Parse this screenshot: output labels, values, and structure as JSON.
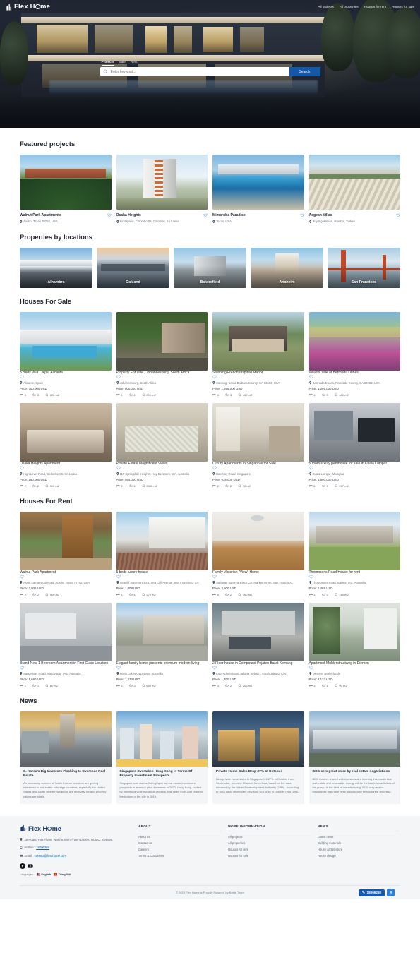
{
  "site": {
    "brand_pre": "Flex H",
    "brand_post": "me",
    "logo_icon": "building-logo-icon"
  },
  "header": {
    "nav": [
      {
        "label": "All projects",
        "name": "nav-all-projects"
      },
      {
        "label": "All properties",
        "name": "nav-all-properties"
      },
      {
        "label": "Houses for rent",
        "name": "nav-houses-for-rent"
      },
      {
        "label": "Houses for sale",
        "name": "nav-houses-for-sale"
      }
    ]
  },
  "search": {
    "tabs": [
      {
        "label": "Projects",
        "active": true
      },
      {
        "label": "Sale",
        "active": false
      },
      {
        "label": "Rent",
        "active": false
      }
    ],
    "placeholder": "Enter keyword...",
    "value": "",
    "button_label": "Search",
    "accent": "#1558a8"
  },
  "featured": {
    "title": "Featured projects",
    "items": [
      {
        "title": "Walnut Park Apartments",
        "address": "Austin, Texas 78753, USA",
        "img": "green-hillside-apartments"
      },
      {
        "title": "Osaka Heights",
        "address": "Kirulapane, Colombo 06, Colombo, Sri Lanka",
        "img": "white-highrise-tower"
      },
      {
        "title": "Mimaroba Paradise",
        "address": "Texas, USA",
        "img": "resort-pool-aerial"
      },
      {
        "title": "Aegean Villas",
        "address": "Büyükçekmece, İstanbul, Turkey",
        "img": "villa-estate-aerial"
      }
    ]
  },
  "locations": {
    "title": "Properties by locations",
    "items": [
      {
        "name": "Alhambra",
        "img": "la-skyline-mountains"
      },
      {
        "name": "Oakland",
        "img": "oakland-waterfront-dusk"
      },
      {
        "name": "Bakersfield",
        "img": "bakersfield-office-building"
      },
      {
        "name": "Anaheim",
        "img": "anaheim-castle-crowd"
      },
      {
        "name": "San Francisco",
        "img": "golden-gate-bridge"
      }
    ]
  },
  "for_sale": {
    "title": "Houses For Sale",
    "items": [
      {
        "title": "3 Beds Villa Calpe, Alicante",
        "address": "Alicante, Spain",
        "price": "Price: 700,000 USD",
        "beds": "3",
        "baths": "3",
        "area": "800 m2",
        "img": "white-villa-pool"
      },
      {
        "title": "Property For sale , Johannesburg, South Africa",
        "address": "Johannesburg, South Africa",
        "price": "Price: 800,000 USD",
        "beds": "4",
        "baths": "4",
        "area": "800 m2",
        "img": "palm-driveway-wall"
      },
      {
        "title": "Stunning French Inspired Manor",
        "address": "Solvang, Santa Barbara County, CA 93463, USA",
        "price": "Price: 1,695,000 USD",
        "beds": "4",
        "baths": "3",
        "area": "450 m2",
        "img": "french-manor-house"
      },
      {
        "title": "Villa for sale at Bermuda Dunes",
        "address": "Bermuda Dunes, Riverside County, CA 92203, USA",
        "price": "Price: 1,295,000 USD",
        "beds": "4",
        "baths": "3",
        "area": "480 m2",
        "img": "desert-villa-palms"
      },
      {
        "title": "Osaka Heights Apartment",
        "address": "High Level Road, Colombo 06, Sri Lanka",
        "price": "Price: 150,000 USD",
        "beds": "2",
        "baths": "2",
        "area": "110 m2",
        "img": "bedroom-interior-beige"
      },
      {
        "title": "Private Estate Magnificent Views",
        "address": "110 Springdale Heights, Hay Denmark, WA, Australia",
        "price": "Price: 694,000 USD",
        "beds": "3",
        "baths": "1",
        "area": "2080 m2",
        "img": "bedroom-floral-quilt"
      },
      {
        "title": "Luxury Apartments in Singapore for Sale",
        "address": "Balestier Road, Singapore",
        "price": "Price: 918,000 USD",
        "beds": "2",
        "baths": "2",
        "area": "78 m2",
        "img": "living-room-curtains"
      },
      {
        "title": "5 room luxury penthouse for sale in Kuala Lumpur",
        "address": "Kuala Lumpur, Malaysia",
        "price": "Price: 1,590,000 USD",
        "beds": "5",
        "baths": "7",
        "area": "377 m2",
        "img": "penthouse-city-view"
      }
    ]
  },
  "for_rent": {
    "title": "Houses For Rent",
    "items": [
      {
        "title": "Walnut Park Apartment",
        "address": "North Lamar Boulevard, Austin, Texas 78753, USA",
        "price": "Price: 2,035 USD",
        "beds": "2",
        "baths": "2",
        "area": "900 m2",
        "img": "balcony-wood-porch"
      },
      {
        "title": "5 beds luxury house",
        "address": "Seacliff San Francisco, Sea Cliff Avenue, San Francisco, CA",
        "price": "Price: 1,808 USD",
        "beds": "5",
        "baths": "4",
        "area": "270 m2",
        "img": "white-house-hedges"
      },
      {
        "title": "Family Victorian \"View\" Home",
        "address": "Safeway San Francisco CA, Market Street, San Francisco,",
        "price": "Price: 2,500 USD",
        "beds": "5",
        "baths": "2",
        "area": "160 m2",
        "img": "empty-room-wood-floor"
      },
      {
        "title": "Thompsons Road House for rent",
        "address": "Thompsons Road, Balwyn VIC, Australia",
        "price": "Price: 1,465 USD",
        "beds": "3",
        "baths": "3",
        "area": "160 m2",
        "img": "suburban-house-lawn"
      },
      {
        "title": "Brand New 1 Bedroom Apartment in First Class Location",
        "address": "Sandy Bay Road, Sandy Bay TAS, Australia",
        "price": "Price: 1,680 USD",
        "beds": "1",
        "baths": "1",
        "area": "80 m2",
        "img": "modern-kitchen-grey"
      },
      {
        "title": "Elegant family home presents premium modern living",
        "address": "North Lakes QLD 4509, Australia",
        "price": "Price: 1,574 USD",
        "beds": "3",
        "baths": "3",
        "area": "658 m2",
        "img": "garage-house-driveway"
      },
      {
        "title": "2 Floor house in Compound Pejaten Barat Kemang",
        "address": "Kota Administrasi Jakarta Selatan, South Jakarta City,",
        "price": "Price: 1,400 USD",
        "beds": "3",
        "baths": "2",
        "area": "206 m2",
        "img": "house-car-driveway-night"
      },
      {
        "title": "Apartment Mulderstraatweg in Diemen",
        "address": "Diemen, Netherlands",
        "price": "Price: 2,123 USD",
        "beds": "3",
        "baths": "1",
        "area": "90 m2",
        "img": "plant-filled-apartment"
      }
    ]
  },
  "news": {
    "title": "News",
    "items": [
      {
        "title": "S. Korea's Big Investors Flocking to Overseas Real Estate",
        "excerpt": "An increasing number of South Korean investors are getting interested in real estate in foreign countries, especially the United States and Japan where regulations are relatively lax and property values are stable.",
        "img": "seoul-statue-skyline"
      },
      {
        "title": "Singapore Overtakes Hong Kong In Terms Of Property Investment Prospects",
        "excerpt": "Singapore now claims the top spot for real estate investment prospects in terms of price increases in 2020. Hong Kong, rocked by months of violent political protests, has fallen from 14th place to the bottom of the pile in 2019.",
        "img": "singapore-highrise-colorful"
      },
      {
        "title": "Private Home Sales Drop 27% In October",
        "excerpt": "New private home sales in Singapore fell 27% in October from September, reported Channel News Asia, based on the data released by the Urban Redevelopment Authority (URA). According to URA data, developers only sold 928 units in October (966 units...",
        "img": "night-city-apartments"
      },
      {
        "title": "BCG sets great store by real estate negotiations",
        "excerpt": "BCG leaders shared with investors at a meeting this month that real estate and renewable energy will be the two main activities of the group. In the field of manufacturing, BCG only retains businesses that have been successfully restructured, reaching...",
        "img": "modern-complex-aerial"
      }
    ]
  },
  "footer": {
    "address": "25 Hoang Hoa Tham, Ward 6, Binh Thanh District, HCMC, Vietnam.",
    "hotline_label": "Hotline:",
    "hotline": "18006268",
    "email_label": "Email:",
    "email": "contact@flex-home.com",
    "socials": [
      {
        "name": "facebook-icon"
      },
      {
        "name": "youtube-icon"
      }
    ],
    "languages_label": "Languages:",
    "languages": [
      {
        "label": "English",
        "active": true
      },
      {
        "label": "Tiếng Việt",
        "active": false
      }
    ],
    "columns": [
      {
        "title": "ABOUT",
        "links": [
          "About us",
          "Contact us",
          "Careers",
          "Terms & Conditions"
        ]
      },
      {
        "title": "MORE INFORMATION",
        "links": [
          "All projects",
          "All properties",
          "Houses for rent",
          "Houses for sale"
        ]
      },
      {
        "title": "NEWS",
        "links": [
          "Latest news",
          "Building materials",
          "House architecture",
          "House design"
        ]
      }
    ],
    "copyright": "© 2019 Flex Home is Proudly Powered by Bottle Team",
    "fab_phone": "18006268",
    "fab_top_icon": "arrow-up-icon"
  }
}
